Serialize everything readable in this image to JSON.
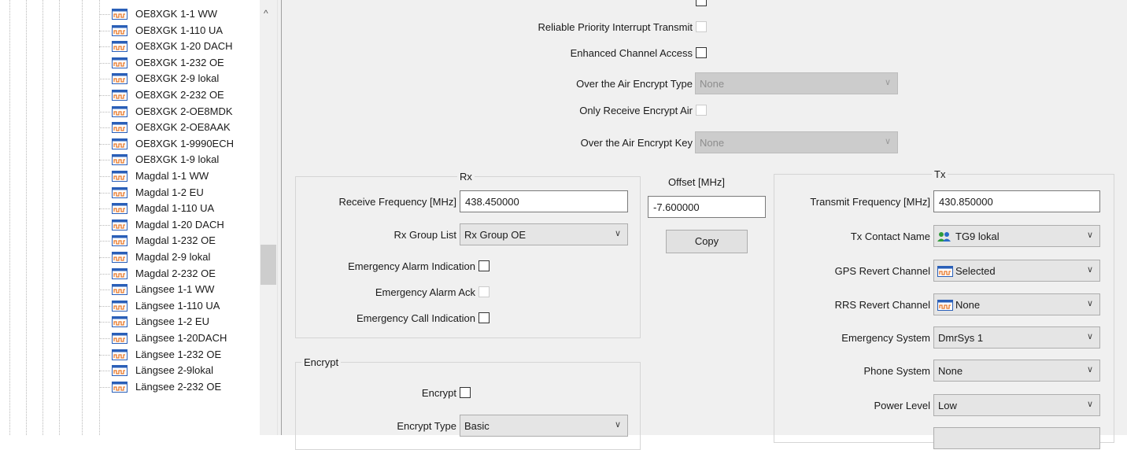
{
  "tree": {
    "items": [
      "OE8XGK 1-1 WW",
      "OE8XGK 1-110 UA",
      "OE8XGK 1-20 DACH",
      "OE8XGK 1-232 OE",
      "OE8XGK 2-9 lokal",
      "OE8XGK 2-232 OE",
      "OE8XGK 2-OE8MDK",
      "OE8XGK 2-OE8AAK",
      "OE8XGK 1-9990ECH",
      "OE8XGK 1-9 lokal",
      "Magdal 1-1 WW",
      "Magdal 1-2 EU",
      "Magdal 1-110 UA",
      "Magdal 1-20 DACH",
      "Magdal 1-232 OE",
      "Magdal 2-9 lokal",
      "Magdal 2-232 OE",
      "Längsee 1-1 WW",
      "Längsee 1-110 UA",
      "Längsee 1-2 EU",
      "Längsee 1-20DACH",
      "Längsee 1-232 OE",
      "Längsee 2-9lokal",
      "Längsee 2-232 OE"
    ],
    "item_icon": "channel-icon",
    "scroll_up_icon": "chevron-up-icon"
  },
  "top": {
    "reliable_priority_label": "Reliable Priority Interrupt Transmit",
    "enhanced_channel_label": "Enhanced Channel Access",
    "ota_encrypt_type_label": "Over the Air Encrypt Type",
    "ota_encrypt_type_value": "None",
    "only_receive_label": "Only Receive Encrypt Air",
    "ota_encrypt_key_label": "Over the Air Encrypt Key",
    "ota_encrypt_key_value": "None"
  },
  "rx": {
    "title": "Rx",
    "receive_freq_label": "Receive Frequency [MHz]",
    "receive_freq_value": "438.450000",
    "group_list_label": "Rx Group List",
    "group_list_value": "Rx Group OE",
    "emergency_alarm_indication_label": "Emergency Alarm Indication",
    "emergency_alarm_ack_label": "Emergency Alarm Ack",
    "emergency_call_indication_label": "Emergency Call Indication"
  },
  "offset": {
    "label": "Offset [MHz]",
    "value": "-7.600000",
    "copy_label": "Copy"
  },
  "tx": {
    "title": "Tx",
    "transmit_freq_label": "Transmit Frequency [MHz]",
    "transmit_freq_value": "430.850000",
    "contact_name_label": "Tx Contact Name",
    "contact_name_value": "TG9 lokal",
    "gps_revert_label": "GPS Revert Channel",
    "gps_revert_value": "Selected",
    "rrs_revert_label": "RRS Revert Channel",
    "rrs_revert_value": "None",
    "emergency_system_label": "Emergency System",
    "emergency_system_value": "DmrSys 1",
    "phone_system_label": "Phone System",
    "phone_system_value": "None",
    "power_level_label": "Power Level",
    "power_level_value": "Low"
  },
  "encrypt": {
    "title": "Encrypt",
    "encrypt_label": "Encrypt",
    "encrypt_type_label": "Encrypt Type",
    "encrypt_type_value": "Basic"
  },
  "colors": {
    "channel_icon_blue": "#2a5fb8",
    "channel_icon_orange": "#e8782a",
    "panel_bg": "#f0f0f0"
  }
}
